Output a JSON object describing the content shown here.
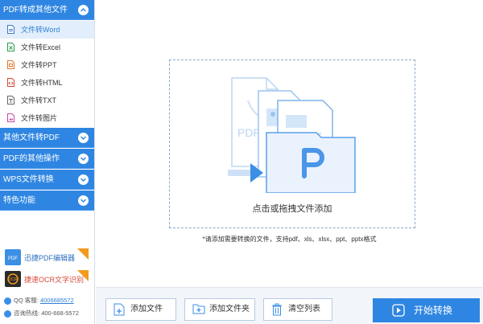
{
  "sidebar": {
    "categories": [
      {
        "label": "PDF转成其他文件"
      },
      {
        "label": "其他文件转PDF"
      },
      {
        "label": "PDF的其他操作"
      },
      {
        "label": "WPS文件转换"
      },
      {
        "label": "特色功能"
      }
    ],
    "sub_items": [
      {
        "label": "文件转Word",
        "active": true
      },
      {
        "label": "文件转Excel"
      },
      {
        "label": "文件转PPT"
      },
      {
        "label": "文件转HTML"
      },
      {
        "label": "文件转TXT"
      },
      {
        "label": "文件转图片"
      }
    ],
    "promos": [
      {
        "label": "迅捷PDF编辑器",
        "logo_text": "PDF"
      },
      {
        "label": "捷速OCR文字识别",
        "logo_text": "OCR"
      }
    ],
    "contact": {
      "qq_label": "QQ 客服:",
      "qq_number": "4006685572",
      "hotline_label": "咨询热线:",
      "hotline_number": "400-668-5572"
    }
  },
  "main": {
    "drop_text": "点击或拖拽文件添加",
    "hint": "*请添加需要转换的文件，支持pdf、xls、xlsx、ppt、pptx格式",
    "buttons": {
      "add_file": "添加文件",
      "add_folder": "添加文件夹",
      "clear_list": "清空列表",
      "start": "开始转换"
    },
    "drop_illustration_text": {
      "pdf_label": "PDF",
      "app_logo": "P"
    }
  },
  "colors": {
    "accent": "#2f86e2",
    "active_bg": "#e2eefb",
    "bottom_bar": "#f2f5f9"
  }
}
